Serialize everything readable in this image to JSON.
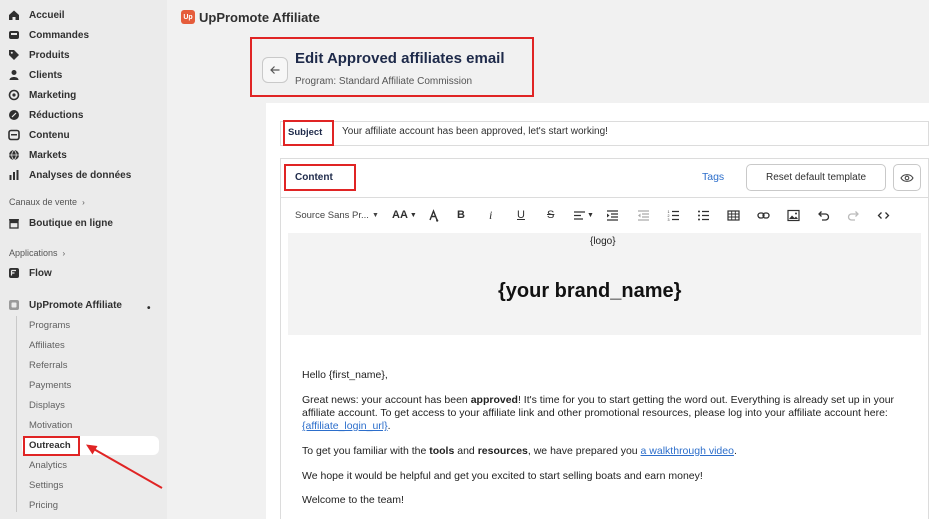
{
  "sidebar": {
    "main_items": [
      {
        "label": "Accueil",
        "icon": "home-icon"
      },
      {
        "label": "Commandes",
        "icon": "inbox-icon"
      },
      {
        "label": "Produits",
        "icon": "tag-icon"
      },
      {
        "label": "Clients",
        "icon": "person-icon"
      },
      {
        "label": "Marketing",
        "icon": "target-icon"
      },
      {
        "label": "Réductions",
        "icon": "discount-icon"
      },
      {
        "label": "Contenu",
        "icon": "content-icon"
      },
      {
        "label": "Markets",
        "icon": "globe-icon"
      },
      {
        "label": "Analyses de données",
        "icon": "chart-icon"
      }
    ],
    "sales_channels_label": "Canaux de vente",
    "online_store_label": "Boutique en ligne",
    "applications_label": "Applications",
    "flow_label": "Flow",
    "app_label": "UpPromote Affiliate",
    "app_sub_items": [
      "Programs",
      "Affiliates",
      "Referrals",
      "Payments",
      "Displays",
      "Motivation",
      "Outreach",
      "Analytics",
      "Settings",
      "Pricing"
    ]
  },
  "header": {
    "app_logo_text": "Up",
    "app_title": "UpPromote Affiliate"
  },
  "page": {
    "title": "Edit Approved affiliates email",
    "subtitle": "Program: Standard Affiliate Commission"
  },
  "subject": {
    "label": "Subject",
    "value": "Your affiliate account has been approved, let's start working!"
  },
  "content": {
    "label": "Content",
    "tags_link": "Tags",
    "reset_button": "Reset default template"
  },
  "toolbar": {
    "font_family": "Source Sans Pr...",
    "font_size_glyph": "AA"
  },
  "email": {
    "logo_placeholder": "{logo}",
    "brand_placeholder": "{your brand_name}",
    "greeting": "Hello {first_name},",
    "p1_a": "Great news: your account has been ",
    "p1_bold": "approved",
    "p1_b": "! It's time for you to start getting the word out. Everything is already set up in your affiliate account. To get access to your affiliate link and other promotional resources, please log into your affiliate account here: ",
    "p1_link": "{affiliate_login_url}",
    "p1_end": ".",
    "p2_a": "To get you familiar with the ",
    "p2_bold1": "tools",
    "p2_mid": " and ",
    "p2_bold2": "resources",
    "p2_b": ", we have prepared you ",
    "p2_link": "a walkthrough video",
    "p2_end": ".",
    "p3": "We hope it would be helpful and get you excited to start selling boats and earn money!",
    "p4": "Welcome to the team!"
  },
  "colors": {
    "annotation_red": "#e02424",
    "link_blue": "#2c6ecb",
    "app_brand": "#e55c3b"
  }
}
